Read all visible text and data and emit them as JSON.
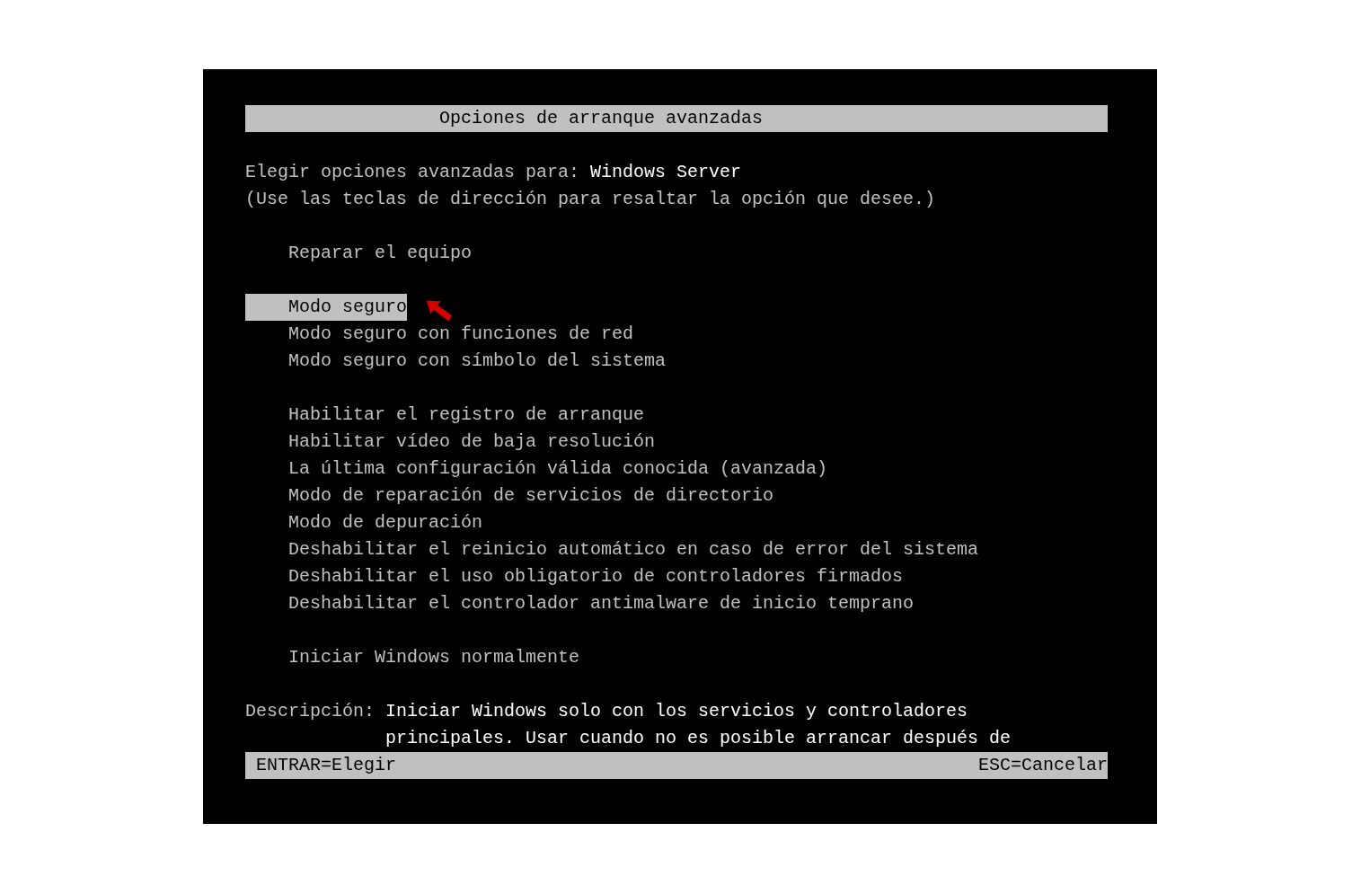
{
  "header": {
    "title": "Opciones de arranque avanzadas"
  },
  "prompt": {
    "label": "Elegir opciones avanzadas para:",
    "target": "Windows Server"
  },
  "hint": "(Use las teclas de dirección para resaltar la opción que desee.)",
  "menu_groups": [
    [
      {
        "label": "Reparar el equipo",
        "selected": false
      }
    ],
    [
      {
        "label": "Modo seguro",
        "selected": true
      },
      {
        "label": "Modo seguro con funciones de red",
        "selected": false
      },
      {
        "label": "Modo seguro con símbolo del sistema",
        "selected": false
      }
    ],
    [
      {
        "label": "Habilitar el registro de arranque",
        "selected": false
      },
      {
        "label": "Habilitar vídeo de baja resolución",
        "selected": false
      },
      {
        "label": "La última configuración válida conocida (avanzada)",
        "selected": false
      },
      {
        "label": "Modo de reparación de servicios de directorio",
        "selected": false
      },
      {
        "label": "Modo de depuración",
        "selected": false
      },
      {
        "label": "Deshabilitar el reinicio automático en caso de error del sistema",
        "selected": false
      },
      {
        "label": "Deshabilitar el uso obligatorio de controladores firmados",
        "selected": false
      },
      {
        "label": "Deshabilitar el controlador antimalware de inicio temprano",
        "selected": false
      }
    ],
    [
      {
        "label": "Iniciar Windows normalmente",
        "selected": false
      }
    ]
  ],
  "description": {
    "label": "Descripción:",
    "lines": [
      "Iniciar Windows solo con los servicios y controladores",
      "principales. Usar cuando no es posible arrancar después de"
    ]
  },
  "footer": {
    "left": "ENTRAR=Elegir",
    "right": "ESC=Cancelar"
  }
}
